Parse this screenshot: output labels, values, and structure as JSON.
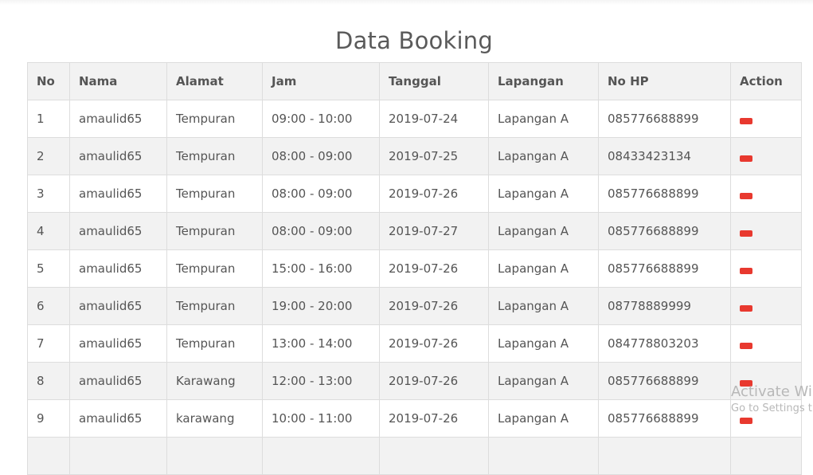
{
  "page": {
    "title": "Data Booking"
  },
  "table": {
    "columns": [
      "No",
      "Nama",
      "Alamat",
      "Jam",
      "Tanggal",
      "Lapangan",
      "No HP",
      "Action"
    ],
    "rows": [
      {
        "no": "1",
        "nama": "amaulid65",
        "alamat": "Tempuran",
        "jam": "09:00 - 10:00",
        "tanggal": "2019-07-24",
        "lapangan": "Lapangan A",
        "nohp": "085776688899"
      },
      {
        "no": "2",
        "nama": "amaulid65",
        "alamat": "Tempuran",
        "jam": "08:00 - 09:00",
        "tanggal": "2019-07-25",
        "lapangan": "Lapangan A",
        "nohp": "08433423134"
      },
      {
        "no": "3",
        "nama": "amaulid65",
        "alamat": "Tempuran",
        "jam": "08:00 - 09:00",
        "tanggal": "2019-07-26",
        "lapangan": "Lapangan A",
        "nohp": "085776688899"
      },
      {
        "no": "4",
        "nama": "amaulid65",
        "alamat": "Tempuran",
        "jam": "08:00 - 09:00",
        "tanggal": "2019-07-27",
        "lapangan": "Lapangan A",
        "nohp": "085776688899"
      },
      {
        "no": "5",
        "nama": "amaulid65",
        "alamat": "Tempuran",
        "jam": "15:00 - 16:00",
        "tanggal": "2019-07-26",
        "lapangan": "Lapangan A",
        "nohp": "085776688899"
      },
      {
        "no": "6",
        "nama": "amaulid65",
        "alamat": "Tempuran",
        "jam": "19:00 - 20:00",
        "tanggal": "2019-07-26",
        "lapangan": "Lapangan A",
        "nohp": "08778889999"
      },
      {
        "no": "7",
        "nama": "amaulid65",
        "alamat": "Tempuran",
        "jam": "13:00 - 14:00",
        "tanggal": "2019-07-26",
        "lapangan": "Lapangan A",
        "nohp": "084778803203"
      },
      {
        "no": "8",
        "nama": "amaulid65",
        "alamat": "Karawang",
        "jam": "12:00 - 13:00",
        "tanggal": "2019-07-26",
        "lapangan": "Lapangan A",
        "nohp": "085776688899"
      },
      {
        "no": "9",
        "nama": "amaulid65",
        "alamat": "karawang",
        "jam": "10:00 - 11:00",
        "tanggal": "2019-07-26",
        "lapangan": "Lapangan A",
        "nohp": "085776688899"
      }
    ],
    "action_color": "#e8392f"
  },
  "watermark": {
    "title": "Activate Wi",
    "subtitle": "Go to Settings t"
  }
}
